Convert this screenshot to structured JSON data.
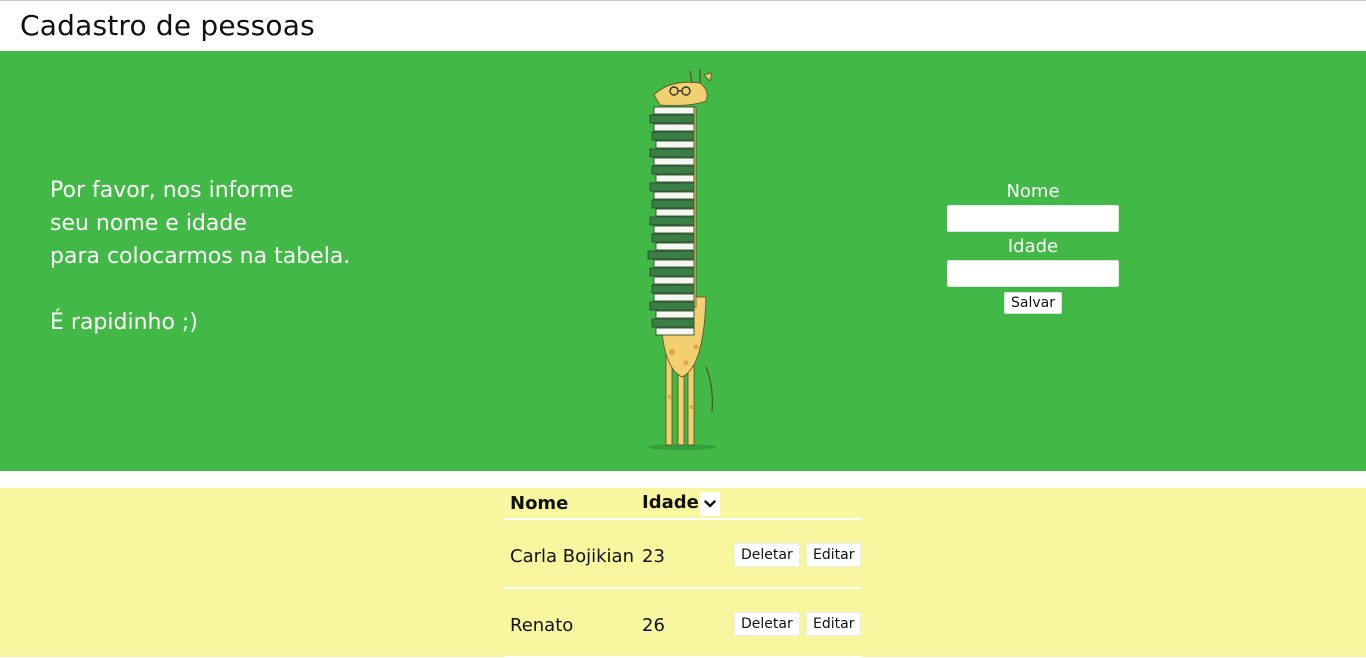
{
  "page": {
    "title": "Cadastro de pessoas"
  },
  "hero": {
    "lines": [
      "Por favor, nos informe",
      "seu nome e idade",
      "para colocarmos na tabela."
    ],
    "tagline": "É rapidinho ;)",
    "illustration": "giraffe-with-books-illustration"
  },
  "form": {
    "name_label": "Nome",
    "name_value": "",
    "age_label": "Idade",
    "age_value": "",
    "save_label": "Salvar"
  },
  "table": {
    "headers": {
      "name": "Nome",
      "age": "Idade"
    },
    "sort_icon": "chevron-down-icon",
    "rows": [
      {
        "name": "Carla Bojikian",
        "age": "23",
        "delete_label": "Deletar",
        "edit_label": "Editar"
      },
      {
        "name": "Renato",
        "age": "26",
        "delete_label": "Deletar",
        "edit_label": "Editar"
      }
    ]
  },
  "colors": {
    "hero_bg": "#42b947",
    "table_bg": "#f8f7a0",
    "text": "#111111"
  }
}
